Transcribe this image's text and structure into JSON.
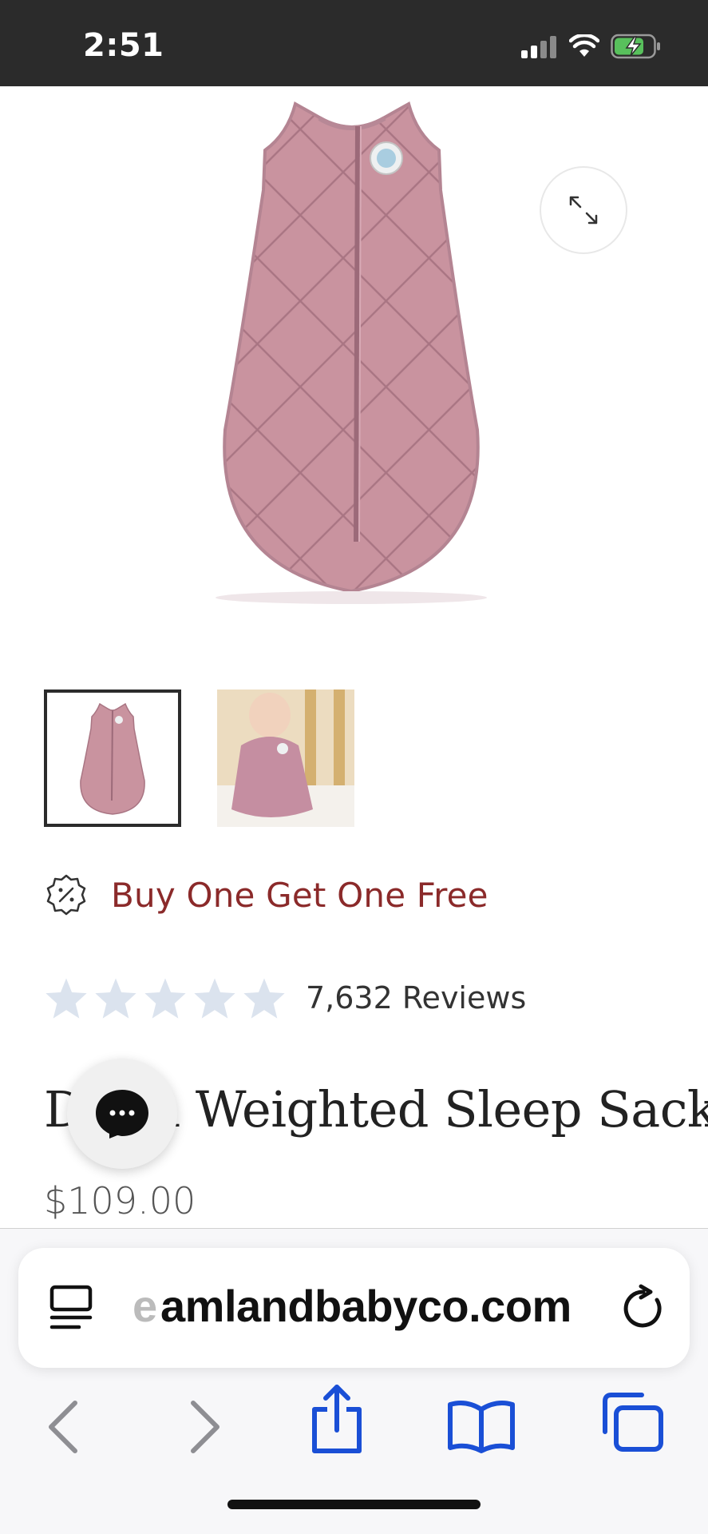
{
  "status_bar": {
    "time": "2:51",
    "signal_icon": "cellular-signal-icon",
    "wifi_icon": "wifi-icon",
    "battery_icon": "battery-charging-icon"
  },
  "product": {
    "title": "Dream Weighted Sleep Sack",
    "title_visible_left": "D",
    "title_visible_right": "n Weighted Sleep Sack",
    "price": "$109.00",
    "promo_text": "Buy One Get One Free",
    "rating_stars": 5,
    "reviews_text": "7,632 Reviews",
    "thumbnail_count": 2
  },
  "browser": {
    "url": "amlandbabyco.com",
    "url_prefix_faded": "e",
    "accent_color": "#1a4fd6"
  },
  "colors": {
    "status_bar_bg": "#2b2b2b",
    "promo_red": "#8b2a2a",
    "star_color": "#dbe3ee",
    "sack_pink": "#c892a8"
  }
}
